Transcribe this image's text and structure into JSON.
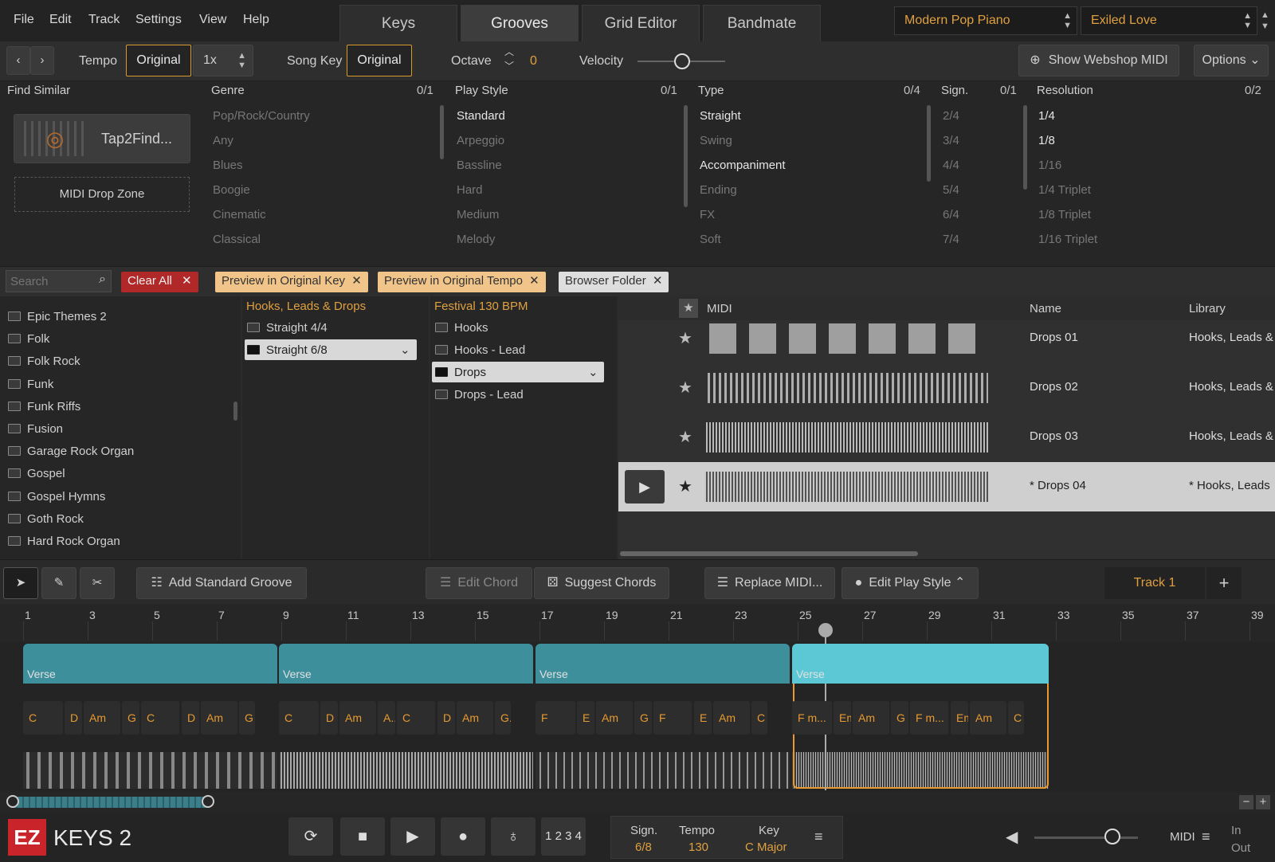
{
  "menu": [
    "File",
    "Edit",
    "Track",
    "Settings",
    "View",
    "Help"
  ],
  "tabs": [
    "Keys",
    "Grooves",
    "Grid Editor",
    "Bandmate"
  ],
  "instrument": "Modern Pop Piano",
  "preset": "Exiled Love",
  "toolbar": {
    "tempo_label": "Tempo",
    "tempo_mode": "Original",
    "tempo_mult": "1x",
    "songkey_label": "Song Key",
    "songkey_value": "Original",
    "octave_label": "Octave",
    "octave_value": "0",
    "velocity_label": "Velocity",
    "webshop": "Show Webshop MIDI",
    "options": "Options"
  },
  "findsimilar": {
    "title": "Find Similar",
    "tap": "Tap2Find...",
    "drop": "MIDI Drop Zone"
  },
  "filters": {
    "genre": {
      "title": "Genre",
      "count": "0/1",
      "items": [
        "Pop/Rock/Country",
        "Any",
        "Blues",
        "Boogie",
        "Cinematic",
        "Classical"
      ]
    },
    "playstyle": {
      "title": "Play Style",
      "count": "0/1",
      "items": [
        "Standard",
        "Arpeggio",
        "Bassline",
        "Hard",
        "Medium",
        "Melody"
      ]
    },
    "type": {
      "title": "Type",
      "count": "0/4",
      "items": [
        "Straight",
        "Swing",
        "Accompaniment",
        "Ending",
        "FX",
        "Soft"
      ]
    },
    "sign": {
      "title": "Sign.",
      "count": "0/1",
      "items": [
        "2/4",
        "3/4",
        "4/4",
        "5/4",
        "6/4",
        "7/4"
      ]
    },
    "resolution": {
      "title": "Resolution",
      "count": "0/2",
      "items": [
        "1/4",
        "1/8",
        "1/16",
        "1/4 Triplet",
        "1/8 Triplet",
        "1/16 Triplet"
      ]
    }
  },
  "tagbar": {
    "search_placeholder": "Search",
    "clear": "Clear All",
    "tags": [
      "Preview in Original Key",
      "Preview in Original Tempo",
      "Browser Folder"
    ]
  },
  "browser": {
    "col1": [
      "Epic Themes 2",
      "Folk",
      "Folk Rock",
      "Funk",
      "Funk Riffs",
      "Fusion",
      "Garage Rock Organ",
      "Gospel",
      "Gospel Hymns",
      "Goth Rock",
      "Hard Rock Organ"
    ],
    "col2_title": "Hooks, Leads & Drops",
    "col2": [
      "Straight 4/4",
      "Straight 6/8"
    ],
    "col3_title": "Festival 130 BPM",
    "col3": [
      "Hooks",
      "Hooks - Lead",
      "Drops",
      "Drops - Lead"
    ]
  },
  "midilist": {
    "col_midi": "MIDI",
    "col_name": "Name",
    "col_library": "Library",
    "rows": [
      {
        "name": "Drops 01",
        "library": "Hooks, Leads &"
      },
      {
        "name": "Drops 02",
        "library": "Hooks, Leads &"
      },
      {
        "name": "Drops 03",
        "library": "Hooks, Leads &"
      },
      {
        "name": "* Drops 04",
        "library": "* Hooks, Leads"
      }
    ]
  },
  "arranger": {
    "add_groove": "Add Standard Groove",
    "edit_chord": "Edit Chord",
    "suggest": "Suggest Chords",
    "replace": "Replace MIDI...",
    "edit_play": "Edit Play Style",
    "track": "Track 1",
    "ruler": [
      "1",
      "3",
      "5",
      "7",
      "9",
      "11",
      "13",
      "15",
      "17",
      "19",
      "21",
      "23",
      "25",
      "27",
      "29",
      "31",
      "33",
      "35",
      "37",
      "39"
    ],
    "parts": [
      "Verse",
      "Verse",
      "Verse",
      "Verse"
    ],
    "chords": [
      "C",
      "D",
      "Am",
      "G",
      "C",
      "D",
      "Am",
      "G",
      "C",
      "D",
      "Am",
      "A...",
      "C",
      "D",
      "Am",
      "G...",
      "F",
      "E",
      "Am",
      "G",
      "F",
      "E",
      "Am",
      "C",
      "F m...",
      "Em",
      "Am",
      "G",
      "F m...",
      "Em",
      "Am",
      "C ..."
    ]
  },
  "transport": {
    "count": "1 2 3 4",
    "sign_label": "Sign.",
    "sign_value": "6/8",
    "tempo_label": "Tempo",
    "tempo_value": "130",
    "key_label": "Key",
    "key_value": "C Major",
    "midi": "MIDI",
    "in": "In",
    "out": "Out",
    "brand": "EZ",
    "product": "KEYS 2"
  }
}
